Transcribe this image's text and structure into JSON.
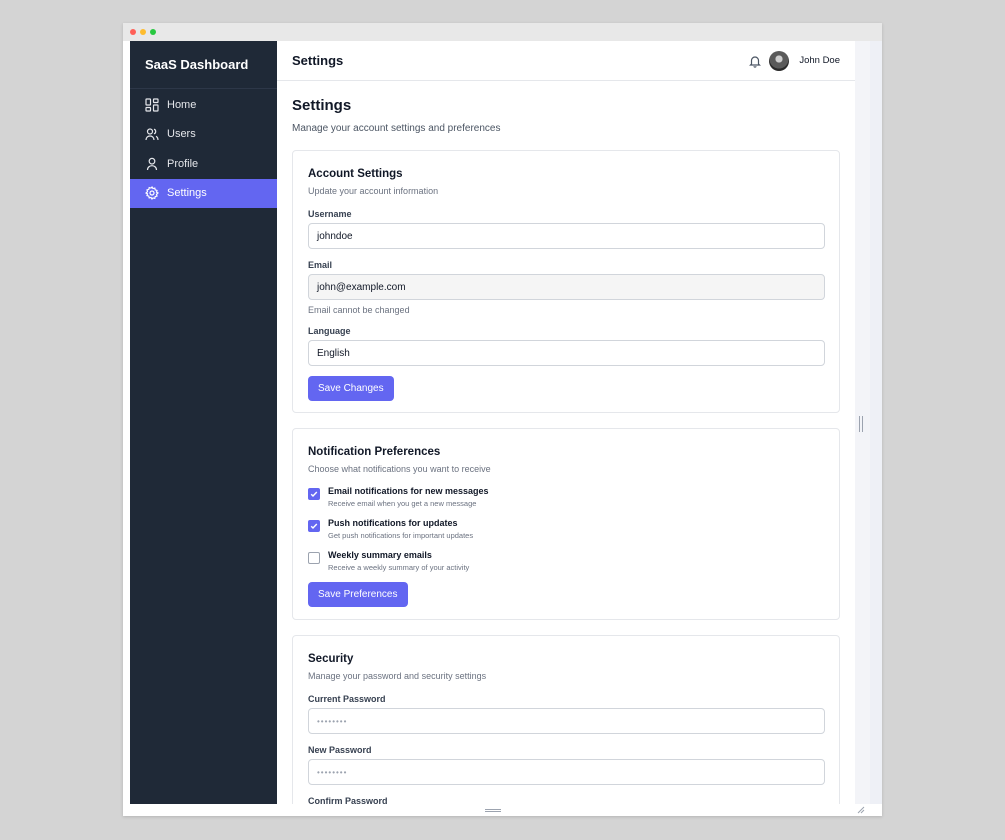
{
  "app": {
    "brand": "SaaS Dashboard"
  },
  "sidebar": {
    "items": [
      {
        "label": "Home",
        "icon": "home-grid-icon",
        "active": false
      },
      {
        "label": "Users",
        "icon": "users-icon",
        "active": false
      },
      {
        "label": "Profile",
        "icon": "user-icon",
        "active": false
      },
      {
        "label": "Settings",
        "icon": "gear-icon",
        "active": true
      }
    ]
  },
  "header": {
    "title": "Settings",
    "user_name": "John Doe",
    "icons": [
      "bell-icon",
      "avatar"
    ]
  },
  "page": {
    "title": "Settings",
    "subtitle": "Manage your account settings and preferences"
  },
  "account": {
    "title": "Account Settings",
    "description": "Update your account information",
    "username_label": "Username",
    "username_value": "johndoe",
    "email_label": "Email",
    "email_value": "john@example.com",
    "email_helper": "Email cannot be changed",
    "language_label": "Language",
    "language_value": "English",
    "save_label": "Save Changes"
  },
  "notifications": {
    "title": "Notification Preferences",
    "description": "Choose what notifications you want to receive",
    "options": [
      {
        "title": "Email notifications for new messages",
        "desc": "Receive email when you get a new message",
        "checked": true
      },
      {
        "title": "Push notifications for updates",
        "desc": "Get push notifications for important updates",
        "checked": true
      },
      {
        "title": "Weekly summary emails",
        "desc": "Receive a weekly summary of your activity",
        "checked": false
      }
    ],
    "save_label": "Save Preferences"
  },
  "security": {
    "title": "Security",
    "description": "Manage your password and security settings",
    "current_label": "Current Password",
    "current_value": "••••••••",
    "new_label": "New Password",
    "new_value": "••••••••",
    "confirm_label": "Confirm Password"
  },
  "colors": {
    "accent": "#6366f1",
    "sidebar_bg": "#1f2937"
  }
}
